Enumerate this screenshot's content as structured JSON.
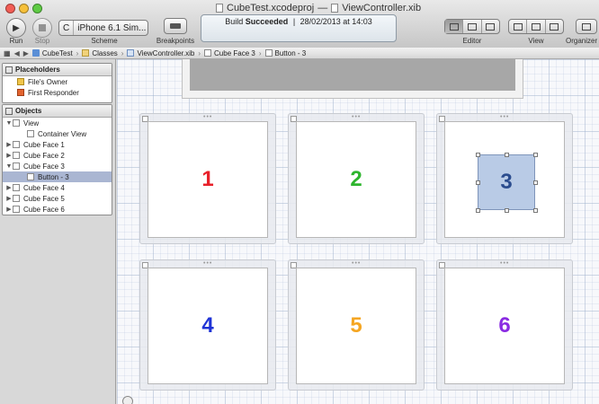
{
  "window": {
    "project": "CubeTest.xcodeproj",
    "separator": "—",
    "file": "ViewController.xib"
  },
  "toolbar": {
    "run_label": "Run",
    "stop_label": "Stop",
    "scheme_label": "Scheme",
    "scheme_target": "C",
    "scheme_device": "iPhone 6.1 Sim...",
    "breakpoints_label": "Breakpoints",
    "editor_label": "Editor",
    "view_label": "View",
    "organizer_label": "Organizer"
  },
  "activity": {
    "prefix": "Build ",
    "status": "Succeeded",
    "divider": "|",
    "timestamp": "28/02/2013 at 14:03"
  },
  "jumpbar": {
    "crumbs": [
      "CubeTest",
      "Classes",
      "ViewController.xib",
      "Cube Face 3",
      "Button - 3"
    ]
  },
  "sidebar": {
    "placeholders_title": "Placeholders",
    "placeholders": [
      "File's Owner",
      "First Responder"
    ],
    "objects_title": "Objects",
    "objects": [
      {
        "label": "View",
        "disclosure": "▼",
        "indent": 0
      },
      {
        "label": "Container View",
        "disclosure": "",
        "indent": 1
      },
      {
        "label": "Cube Face 1",
        "disclosure": "▶",
        "indent": 0
      },
      {
        "label": "Cube Face 2",
        "disclosure": "▶",
        "indent": 0
      },
      {
        "label": "Cube Face 3",
        "disclosure": "▼",
        "indent": 0
      },
      {
        "label": "Button - 3",
        "disclosure": "",
        "indent": 1,
        "selected": true
      },
      {
        "label": "Cube Face 4",
        "disclosure": "▶",
        "indent": 0
      },
      {
        "label": "Cube Face 5",
        "disclosure": "▶",
        "indent": 0
      },
      {
        "label": "Cube Face 6",
        "disclosure": "▶",
        "indent": 0
      }
    ]
  },
  "canvas": {
    "faces": [
      {
        "label": "1",
        "color": "#e8202a"
      },
      {
        "label": "2",
        "color": "#2db52d"
      },
      {
        "label": "3",
        "color": "#2b4c8e"
      },
      {
        "label": "4",
        "color": "#1f33d6"
      },
      {
        "label": "5",
        "color": "#f5a623"
      },
      {
        "label": "6",
        "color": "#8a2be2"
      }
    ]
  },
  "icons": {
    "run": "play-icon",
    "stop": "stop-icon",
    "breakpoints": "breakpoint-icon"
  }
}
